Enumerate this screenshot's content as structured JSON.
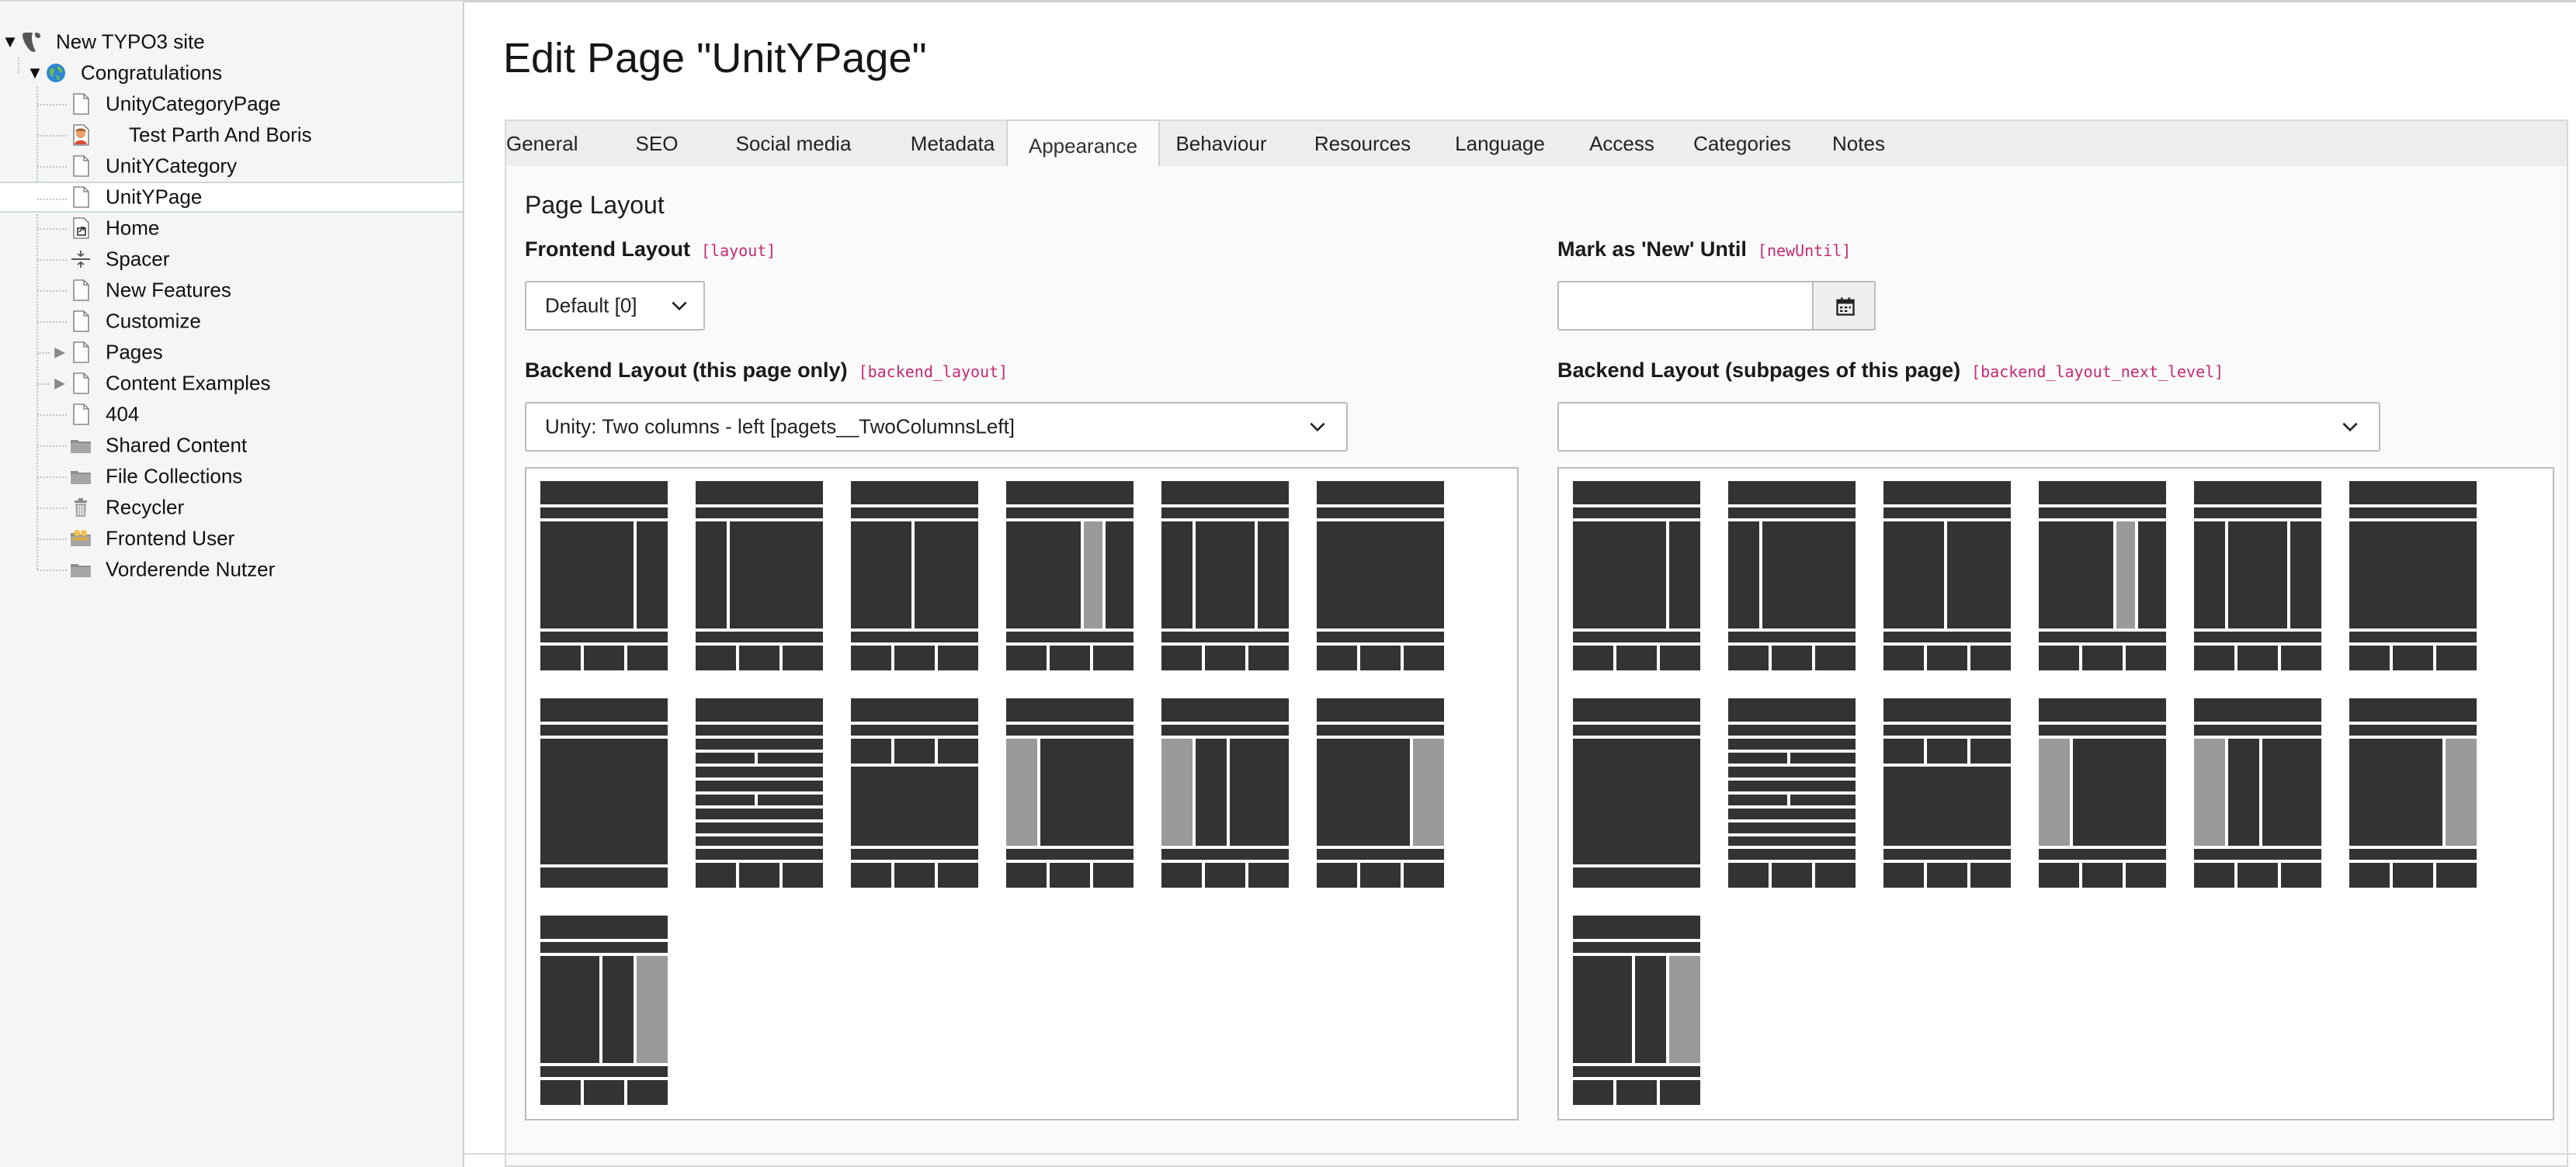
{
  "tree": {
    "items": [
      {
        "label": "New TYPO3 site",
        "icon": "typo3-logo-icon",
        "level": 0,
        "toggle": "expanded"
      },
      {
        "label": "Congratulations",
        "icon": "globe-icon",
        "level": 1,
        "toggle": "expanded"
      },
      {
        "label": "UnityCategoryPage",
        "icon": "page-icon",
        "level": 2,
        "toggle": "none"
      },
      {
        "label": "Test Parth And Boris",
        "icon": "user-page-icon",
        "level": 2,
        "toggle": "none"
      },
      {
        "label": "UnitYCategory",
        "icon": "page-icon",
        "level": 2,
        "toggle": "none"
      },
      {
        "label": "UnitYPage",
        "icon": "page-icon",
        "level": 2,
        "toggle": "none",
        "selected": true
      },
      {
        "label": "Home",
        "icon": "shortcut-page-icon",
        "level": 2,
        "toggle": "none"
      },
      {
        "label": "Spacer",
        "icon": "spacer-icon",
        "level": 2,
        "toggle": "none"
      },
      {
        "label": "New Features",
        "icon": "page-icon",
        "level": 2,
        "toggle": "none"
      },
      {
        "label": "Customize",
        "icon": "page-icon",
        "level": 2,
        "toggle": "none"
      },
      {
        "label": "Pages",
        "icon": "page-icon",
        "level": 2,
        "toggle": "collapsed"
      },
      {
        "label": "Content Examples",
        "icon": "page-icon",
        "level": 2,
        "toggle": "collapsed"
      },
      {
        "label": "404",
        "icon": "page-icon",
        "level": 2,
        "toggle": "none"
      },
      {
        "label": "Shared Content",
        "icon": "folder-icon",
        "level": 2,
        "toggle": "none"
      },
      {
        "label": "File Collections",
        "icon": "folder-icon",
        "level": 2,
        "toggle": "none"
      },
      {
        "label": "Recycler",
        "icon": "trash-icon",
        "level": 2,
        "toggle": "none"
      },
      {
        "label": "Frontend User",
        "icon": "users-folder-icon",
        "level": 2,
        "toggle": "none"
      },
      {
        "label": "Vorderende Nutzer",
        "icon": "folder-icon",
        "level": 2,
        "toggle": "none"
      }
    ]
  },
  "page": {
    "title": "Edit Page \"UnitYPage\""
  },
  "tabs": [
    {
      "label": "General"
    },
    {
      "label": "SEO"
    },
    {
      "label": "Social media"
    },
    {
      "label": "Metadata"
    },
    {
      "label": "Appearance",
      "active": true
    },
    {
      "label": "Behaviour"
    },
    {
      "label": "Resources"
    },
    {
      "label": "Language"
    },
    {
      "label": "Access"
    },
    {
      "label": "Categories"
    },
    {
      "label": "Notes"
    }
  ],
  "section": {
    "title": "Page Layout"
  },
  "fields": {
    "frontend_layout": {
      "label": "Frontend Layout",
      "key": "[layout]",
      "value": "Default [0]"
    },
    "new_until": {
      "label": "Mark as 'New' Until",
      "key": "[newUntil]",
      "value": "",
      "icon": "calendar-icon"
    },
    "backend_layout": {
      "label": "Backend Layout (this page only)",
      "key": "[backend_layout]",
      "value": "Unity: Two columns - left [pagets__TwoColumnsLeft]"
    },
    "backend_layout_next": {
      "label": "Backend Layout (subpages of this page)",
      "key": "[backend_layout_next_level]",
      "value": ""
    }
  },
  "layouts": [
    {
      "name": "two-columns-right-sidebar"
    },
    {
      "name": "two-columns-left-sidebar"
    },
    {
      "name": "two-columns-equal"
    },
    {
      "name": "three-columns-grey-middle"
    },
    {
      "name": "three-columns"
    },
    {
      "name": "one-column"
    },
    {
      "name": "one-column-tall"
    },
    {
      "name": "rows-grid"
    },
    {
      "name": "three-top-one-main"
    },
    {
      "name": "grey-left-main"
    },
    {
      "name": "grey-left-three-columns"
    },
    {
      "name": "main-grey-right"
    },
    {
      "name": "three-columns-grey-right"
    }
  ],
  "colors": {
    "accent_key": "#c42a73",
    "thumb_dark": "#333333",
    "thumb_grey": "#9a9a9a"
  }
}
